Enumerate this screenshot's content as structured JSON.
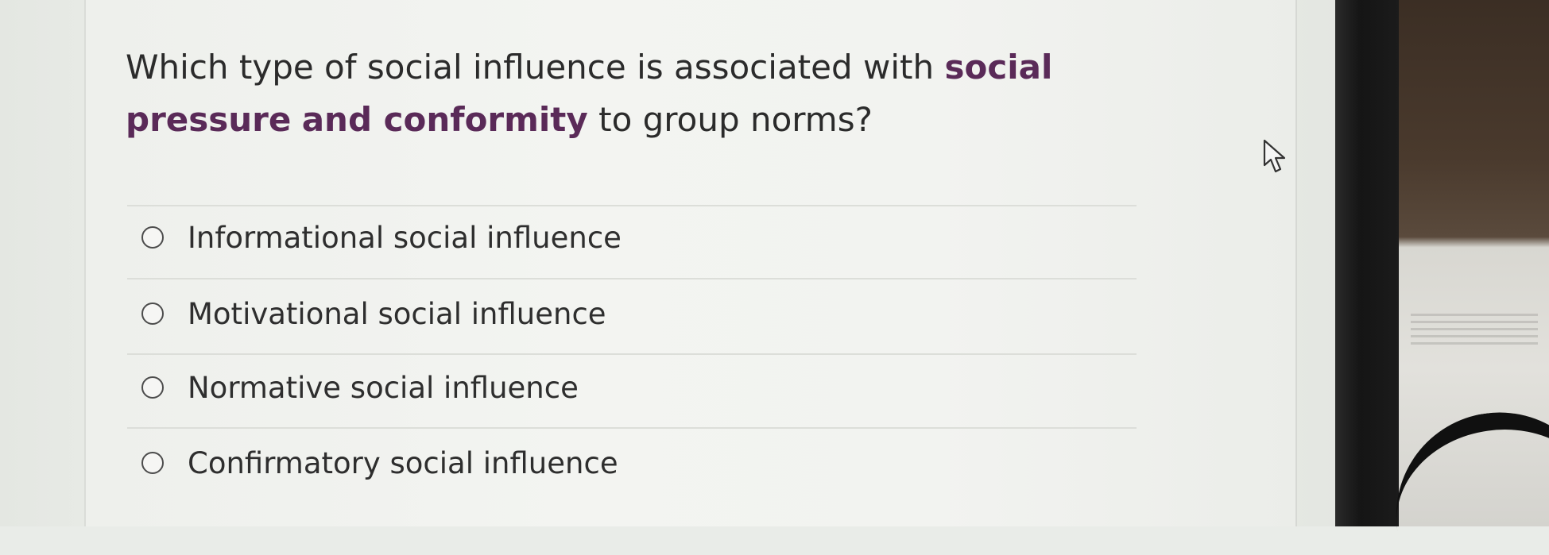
{
  "question": {
    "text_before": "Which type of social influence is associated with ",
    "emphasis_1": "social pressure",
    "text_middle": " ",
    "emphasis_2": "and conformity",
    "text_after": " to group norms?"
  },
  "options": [
    {
      "label": "Informational social influence",
      "selected": false
    },
    {
      "label": "Motivational social influence",
      "selected": false
    },
    {
      "label": "Normative social influence",
      "selected": false
    },
    {
      "label": "Confirmatory social influence",
      "selected": false
    }
  ],
  "colors": {
    "emphasis": "#5a2a58",
    "text": "#2b2b2b"
  }
}
